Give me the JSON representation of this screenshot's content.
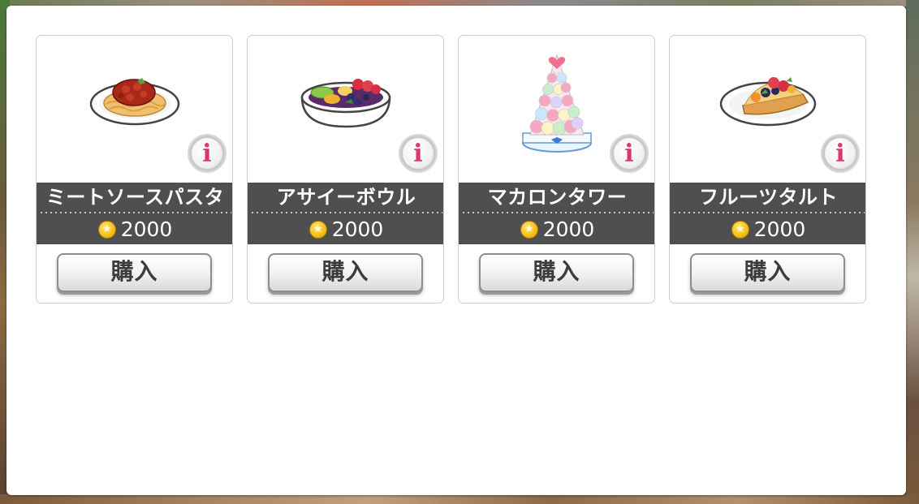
{
  "shop": {
    "currency_icon": "gold-coin-icon",
    "info_icon": "info-icon",
    "colors": {
      "bar_bg": "#4f4f4f",
      "info_accent": "#e0356a",
      "coin": "#f6c21a"
    },
    "items": [
      {
        "name": "ミートソースパスタ",
        "price": "2000",
        "buy_label": "購入",
        "info_label": "i",
        "image_icon": "meat-sauce-pasta-icon"
      },
      {
        "name": "アサイーボウル",
        "price": "2000",
        "buy_label": "購入",
        "info_label": "i",
        "image_icon": "acai-bowl-icon"
      },
      {
        "name": "マカロンタワー",
        "price": "2000",
        "buy_label": "購入",
        "info_label": "i",
        "image_icon": "macaron-tower-icon"
      },
      {
        "name": "フルーツタルト",
        "price": "2000",
        "buy_label": "購入",
        "info_label": "i",
        "image_icon": "fruit-tart-icon"
      }
    ]
  }
}
